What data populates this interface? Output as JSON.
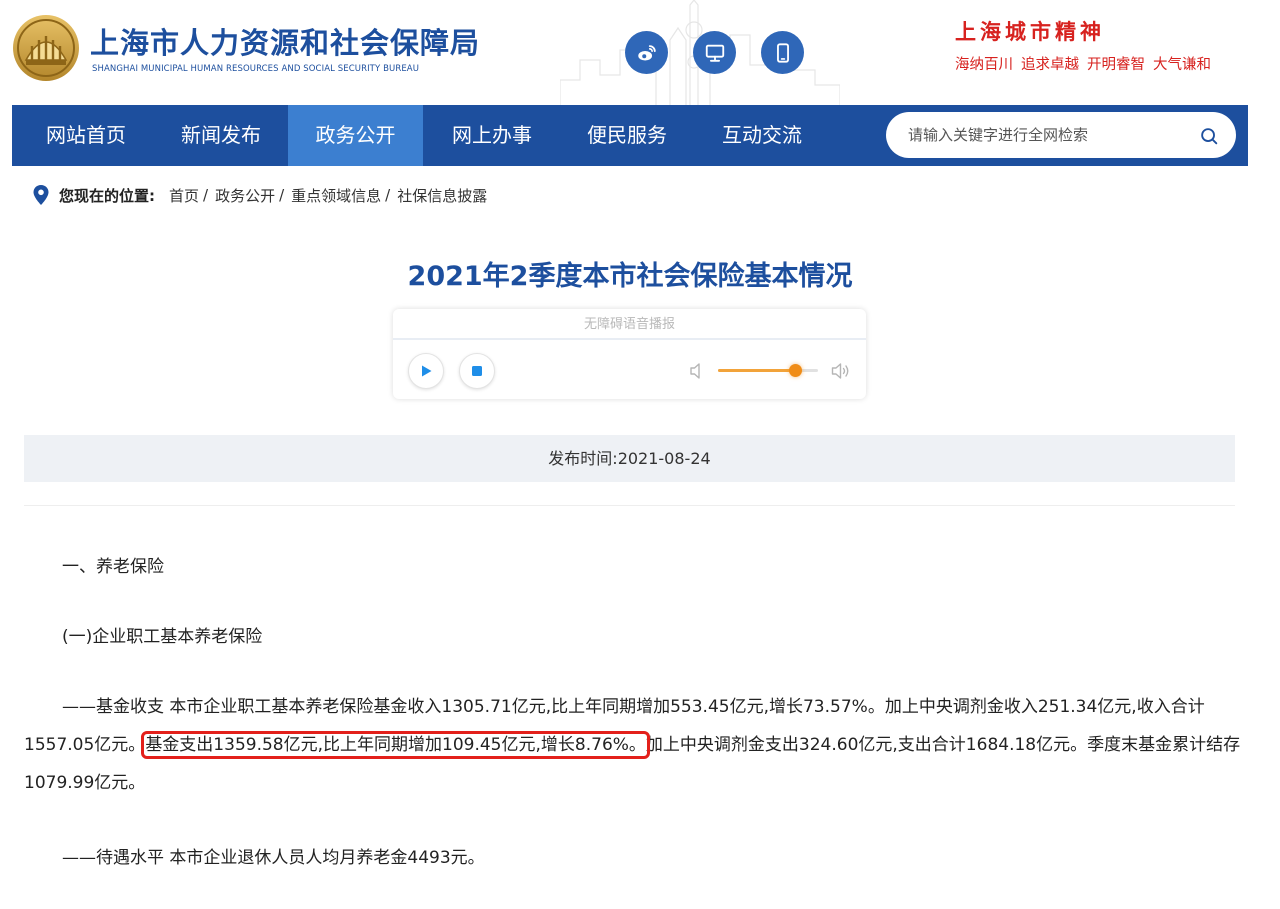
{
  "header": {
    "site_name_cn": "上海市人力资源和社会保障局",
    "site_name_en": "SHANGHAI MUNICIPAL HUMAN RESOURCES AND SOCIAL SECURITY BUREAU",
    "spirit_title": "上海城市精神",
    "spirit_words": [
      "海纳百川",
      "追求卓越",
      "开明睿智",
      "大气谦和"
    ],
    "icons": [
      "weibo-icon",
      "desktop-icon",
      "mobile-icon"
    ]
  },
  "nav": {
    "items": [
      "网站首页",
      "新闻发布",
      "政务公开",
      "网上办事",
      "便民服务",
      "互动交流"
    ],
    "active_index": 2,
    "search_placeholder": "请输入关键字进行全网检索"
  },
  "breadcrumb": {
    "label": "您现在的位置:",
    "items": [
      "首页",
      "政务公开",
      "重点领域信息",
      "社保信息披露"
    ]
  },
  "article": {
    "title": "2021年2季度本市社会保险基本情况",
    "player_title": "无障碍语音播报",
    "volume_level": 0.77,
    "publish_date": "发布时间:2021-08-24",
    "section1": "一、养老保险",
    "subsection1": "(一)企业职工基本养老保险",
    "para1_before": "——基金收支 本市企业职工基本养老保险基金收入1305.71亿元,比上年同期增加553.45亿元,增长73.57%。加上中央调剂金收入251.34亿元,收入合计1557.05亿元。",
    "para1_highlight": "基金支出1359.58亿元,比上年同期增加109.45亿元,增长8.76%。",
    "para1_after": "加上中央调剂金支出324.60亿元,支出合计1684.18亿元。季度末基金累计结存1079.99亿元。",
    "para2": "——待遇水平 本市企业退休人员人均月养老金4493元。"
  },
  "colors": {
    "brand_blue": "#1d4f9e",
    "nav_active": "#3c7fd0",
    "highlight_red": "#e3201b",
    "spirit_red": "#d7221f"
  }
}
